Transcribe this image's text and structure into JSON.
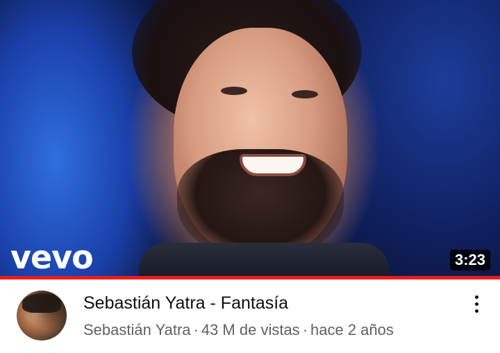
{
  "video": {
    "thumbnail_icon": "performer-closeup",
    "logo_text": "vevo",
    "duration": "3:23",
    "watched_progress": 1.0,
    "progress_color": "#ee1c1c"
  },
  "details": {
    "title": "Sebastián Yatra - Fantasía",
    "channel": "Sebastián Yatra",
    "separator": "·",
    "views": "43 M de vistas",
    "age": "hace 2 años",
    "more_icon": "more-vertical-icon"
  }
}
